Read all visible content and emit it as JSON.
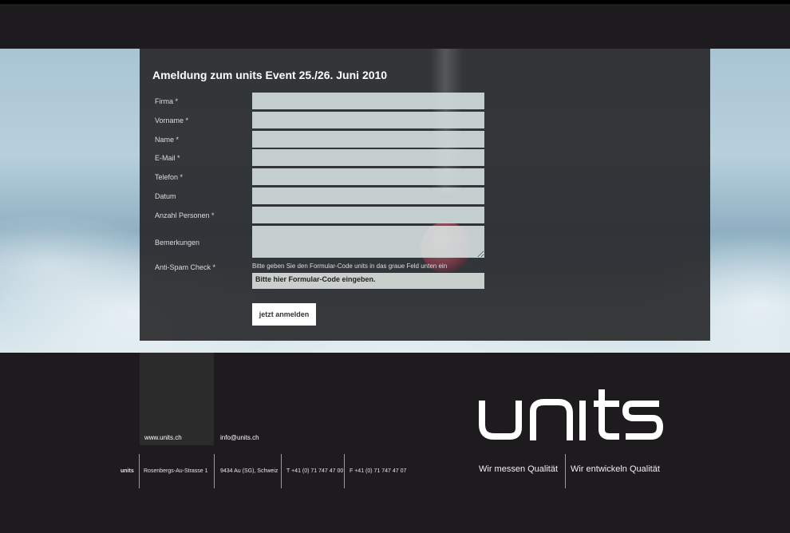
{
  "form": {
    "title": "Ameldung zum units Event 25./26. Juni 2010",
    "fields": [
      {
        "label": "Firma *"
      },
      {
        "label": "Vorname *"
      },
      {
        "label": "Name *"
      },
      {
        "label": "E-Mail *"
      },
      {
        "label": "Telefon *"
      },
      {
        "label": "Datum"
      },
      {
        "label": "Anzahl Personen *"
      },
      {
        "label": "Bemerkungen"
      }
    ],
    "spam": {
      "label": "Anti-Spam Check *",
      "hint": "Bitte geben Sie den Formular-Code units in das graue Feld unten ein",
      "placeholder": "Bitte hier Formular-Code eingeben."
    },
    "submit_label": "jetzt anmelden"
  },
  "footer": {
    "www": "www.units.ch",
    "email": "info@units.ch",
    "address": {
      "brand": "units",
      "street": "Rosenbergs-Au-Strasse 1",
      "city": "9434 Au (SG), Schweiz",
      "phone": "T +41 (0) 71 747 47 00",
      "fax": "F +41 (0) 71 747 47  07"
    },
    "logo_text": "units",
    "tagline_left": "Wir messen Qualität",
    "tagline_right": "Wir entwickeln Qualität"
  },
  "colors": {
    "background": "#1e1b1f",
    "panel": "#262628",
    "field": "#dae4e2",
    "text": "#ffffff"
  }
}
